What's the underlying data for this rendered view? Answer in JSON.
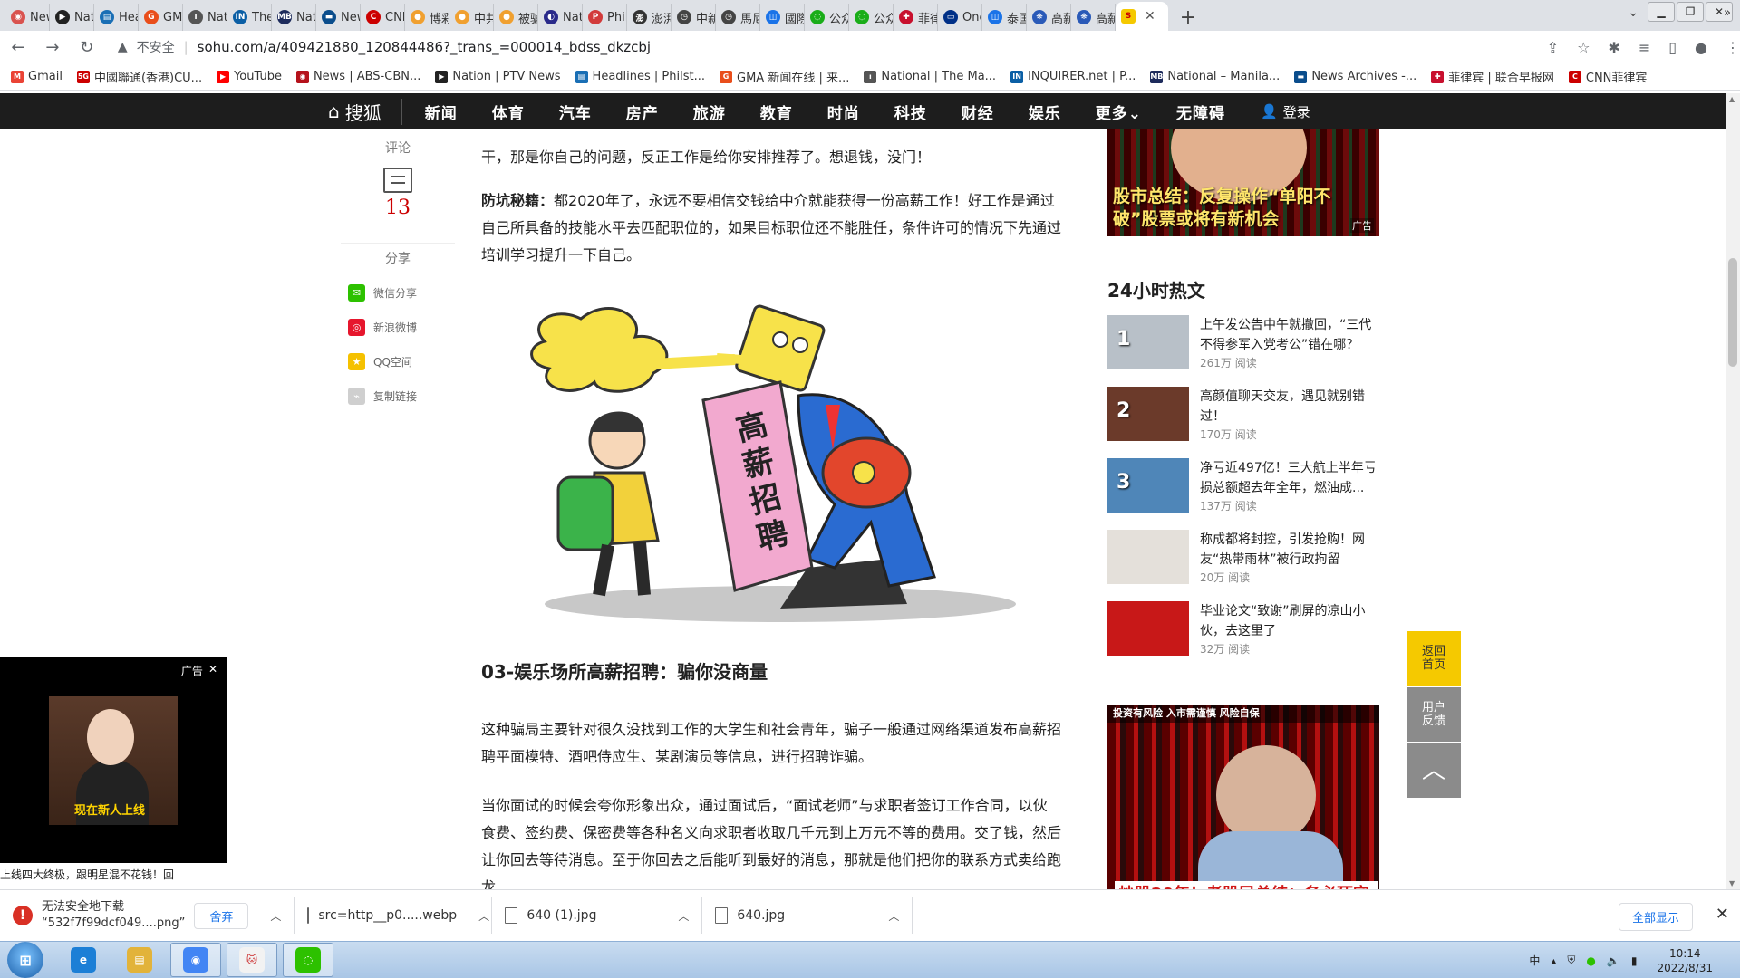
{
  "browser": {
    "tabs": [
      {
        "label": "New",
        "color": "#d9534f",
        "glyph": "◉"
      },
      {
        "label": "Nati",
        "color": "#222222",
        "glyph": "▶"
      },
      {
        "label": "Hea",
        "color": "#1a6fb5",
        "glyph": "▤"
      },
      {
        "label": "GM",
        "color": "#e94e1b",
        "glyph": "G"
      },
      {
        "label": "Nati",
        "color": "#555555",
        "glyph": "ı"
      },
      {
        "label": "The",
        "color": "#0b5fa5",
        "glyph": "IN"
      },
      {
        "label": "Nati",
        "color": "#1d2b5c",
        "glyph": "MB"
      },
      {
        "label": "New",
        "color": "#0a4d8c",
        "glyph": "▬"
      },
      {
        "label": "CNN",
        "color": "#cc0000",
        "glyph": "C"
      },
      {
        "label": "博彩",
        "color": "#f0a030",
        "glyph": "●"
      },
      {
        "label": "中共",
        "color": "#f0a030",
        "glyph": "●"
      },
      {
        "label": "被骗",
        "color": "#f0a030",
        "glyph": "●"
      },
      {
        "label": "Nati",
        "color": "#2a2a8a",
        "glyph": "◐"
      },
      {
        "label": "Phili",
        "color": "#d23b3b",
        "glyph": "P"
      },
      {
        "label": "澎湃",
        "color": "#333333",
        "glyph": "澎"
      },
      {
        "label": "中新",
        "color": "#444444",
        "glyph": "◷"
      },
      {
        "label": "馬尼",
        "color": "#444444",
        "glyph": "◷"
      },
      {
        "label": "國際",
        "color": "#1a73e8",
        "glyph": "◫"
      },
      {
        "label": "公众",
        "color": "#1aad19",
        "glyph": "◌"
      },
      {
        "label": "公众",
        "color": "#1aad19",
        "glyph": "◌"
      },
      {
        "label": "菲律",
        "color": "#c8102e",
        "glyph": "✚"
      },
      {
        "label": "One",
        "color": "#003087",
        "glyph": "▭"
      },
      {
        "label": "泰国",
        "color": "#1a73e8",
        "glyph": "◫"
      },
      {
        "label": "高薪",
        "color": "#2a5ab8",
        "glyph": "❋"
      },
      {
        "label": "高薪",
        "color": "#2a5ab8",
        "glyph": "❋"
      }
    ],
    "active_tab": {
      "label": "",
      "color": "#f5c900",
      "glyph": "S"
    },
    "new_tab": "+",
    "tab_search": "⌄",
    "window_controls": {
      "minimize": "▁",
      "restore": "❐",
      "close": "✕"
    },
    "address": {
      "insecure_label": "不安全",
      "url": "sohu.com/a/409421880_120844486?_trans_=000014_bdss_dkzcbj"
    },
    "bookmarks": [
      {
        "label": "Gmail",
        "color": "#ea4335",
        "glyph": "M"
      },
      {
        "label": "中國聯通(香港)CU...",
        "color": "#cc0000",
        "glyph": "5G"
      },
      {
        "label": "YouTube",
        "color": "#ff0000",
        "glyph": "▶"
      },
      {
        "label": "News | ABS-CBN...",
        "color": "#b5121b",
        "glyph": "◉"
      },
      {
        "label": "Nation | PTV News",
        "color": "#222222",
        "glyph": "▶"
      },
      {
        "label": "Headlines | Philst...",
        "color": "#1a6fb5",
        "glyph": "▤"
      },
      {
        "label": "GMA 新闻在线 | 来...",
        "color": "#e94e1b",
        "glyph": "G"
      },
      {
        "label": "National | The Ma...",
        "color": "#555555",
        "glyph": "ı"
      },
      {
        "label": "INQUIRER.net | P...",
        "color": "#0b5fa5",
        "glyph": "IN"
      },
      {
        "label": "National – Manila...",
        "color": "#1d2b5c",
        "glyph": "MB"
      },
      {
        "label": "News Archives -...",
        "color": "#0a4d8c",
        "glyph": "▬"
      },
      {
        "label": "菲律宾 | 联合早报网",
        "color": "#c8102e",
        "glyph": "✚"
      },
      {
        "label": "CNN菲律宾",
        "color": "#cc0000",
        "glyph": "C"
      }
    ],
    "bookmarks_more": "»"
  },
  "site_nav": {
    "logo": "搜狐",
    "items": [
      "新闻",
      "体育",
      "汽车",
      "房产",
      "旅游",
      "教育",
      "时尚",
      "科技",
      "财经",
      "娱乐",
      "更多",
      "无障碍"
    ],
    "more_suffix": "⌄",
    "login": "登录"
  },
  "left_rail": {
    "comment_label": "评论",
    "comment_count": "13",
    "share_label": "分享",
    "share_items": [
      {
        "label": "微信分享",
        "color": "#2dc100",
        "glyph": "✉"
      },
      {
        "label": "新浪微博",
        "color": "#e6162d",
        "glyph": "◎"
      },
      {
        "label": "QQ空间",
        "color": "#f5c100",
        "glyph": "★"
      },
      {
        "label": "复制链接",
        "color": "#cfcfcf",
        "glyph": "⌁"
      }
    ]
  },
  "article": {
    "para1": "干，那是你自己的问题，反正工作是给你安排推荐了。想退钱，没门！",
    "para2_bold": "防坑秘籍：",
    "para2": "都2020年了，永远不要相信交钱给中介就能获得一份高薪工作！好工作是通过自己所具备的技能水平去匹配职位的，如果目标职位还不能胜任，条件许可的情况下先通过培训学习提升一下自己。",
    "cartoon_sign": [
      "高",
      "薪",
      "招",
      "聘"
    ],
    "section_title": "03-娱乐场所高薪招聘：骗你没商量",
    "para3": "这种骗局主要针对很久没找到工作的大学生和社会青年，骗子一般通过网络渠道发布高薪招聘平面模特、酒吧侍应生、某剧演员等信息，进行招聘诈骗。",
    "para4": "当你面试的时候会夸你形象出众，通过面试后，“面试老师”与求职者签订工作合同，以伙食费、签约费、保密费等各种名义向求职者收取几千元到上万元不等的费用。交了钱，然后让你回去等待消息。至于你回去之后能听到最好的消息，那就是他们把你的联系方式卖给跑龙"
  },
  "right_rail": {
    "top_ad": {
      "caption": "股市总结：反复操作“单阳不破”股票或将有新机会",
      "tag": "广告"
    },
    "hot_title": "24小时热文",
    "hot_items": [
      {
        "num": "1",
        "title": "上午发公告中午就撤回，“三代不得参军入党考公”错在哪？",
        "reads": "261万 阅读",
        "bg": "#b8c0c8"
      },
      {
        "num": "2",
        "title": "高颜值聊天交友，遇见就别错过！",
        "reads": "170万 阅读",
        "bg": "#6b3a2a"
      },
      {
        "num": "3",
        "title": "净亏近497亿！三大航上半年亏损总额超去年全年，燃油成...",
        "reads": "137万 阅读",
        "bg": "#4f86b8"
      },
      {
        "num": "",
        "title": "称成都将封控，引发抢购！网友“热带雨林”被行政拘留",
        "reads": "20万 阅读",
        "bg": "#e4e0da"
      },
      {
        "num": "",
        "title": "毕业论文“致谢”刷屏的凉山小伙，去这里了",
        "reads": "32万 阅读",
        "bg": "#c81818"
      }
    ],
    "big_ad": {
      "warning": "投资有风险 入市需谨慎 风险自保",
      "caption": "炒股20年！老股民总结：务必死守"
    }
  },
  "float_buttons": {
    "home": "返回首页",
    "feedback": "用户反馈",
    "top": "︿"
  },
  "left_ad": {
    "label": "广告",
    "close": "✕",
    "caption": "现在新人上线",
    "text": "上线四大终极，跟明星混不花钱！回"
  },
  "downloads": {
    "items": [
      {
        "status": "无法安全地下载",
        "name": "“532f7f99dcf049....png”",
        "discard": "舍弃"
      },
      {
        "name": "src=http__p0.....webp"
      },
      {
        "name": "640 (1).jpg"
      },
      {
        "name": "640.jpg"
      }
    ],
    "show_all": "全部显示",
    "close": "✕"
  },
  "taskbar": {
    "apps": [
      {
        "name": "ie",
        "color": "#1c7fd6",
        "glyph": "e"
      },
      {
        "name": "explorer",
        "color": "#e2b33a",
        "glyph": "▤"
      },
      {
        "name": "chrome",
        "color": "#4285f4",
        "glyph": "◉"
      },
      {
        "name": "cat",
        "color": "#f2f2f2",
        "glyph": "🐱"
      },
      {
        "name": "wechat",
        "color": "#2dc100",
        "glyph": "◌"
      }
    ],
    "ime": "中",
    "time": "10:14",
    "date": "2022/8/31"
  }
}
